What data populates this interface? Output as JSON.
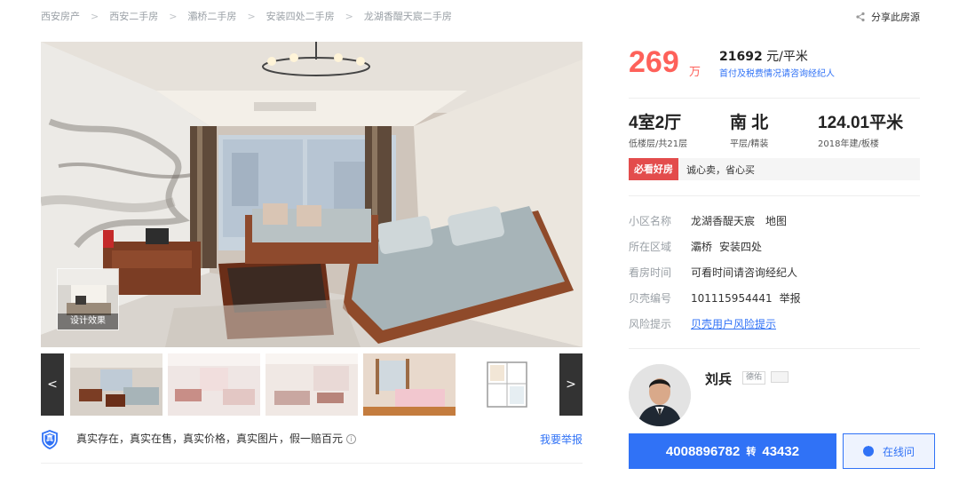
{
  "breadcrumb": [
    {
      "label": "西安房产"
    },
    {
      "label": "西安二手房"
    },
    {
      "label": "灞桥二手房"
    },
    {
      "label": "安装四处二手房"
    },
    {
      "label": "龙湖香醍天宸二手房"
    }
  ],
  "breadcrumb_sep": ">",
  "share": {
    "label": "分享此房源",
    "icon": "share-icon"
  },
  "gallery": {
    "design_label": "设计效果",
    "prev": "<",
    "next": ">",
    "thumbnails": [
      "living-room",
      "living-room-bright",
      "living-room-side",
      "bedroom",
      "floor-plan"
    ]
  },
  "guarantee": {
    "text": "真实存在，真实在售，真实价格，真实图片，假一赔百元",
    "badge": "真",
    "info_icon": "i",
    "report_label": "我要举报"
  },
  "price": {
    "total": "269",
    "total_unit": "万",
    "unit_price": "21692",
    "unit_price_suffix": " 元/平米",
    "tax_note": "首付及税费情况请咨询经纪人"
  },
  "room": [
    {
      "main": "4室2厅",
      "sub": "低楼层/共21层"
    },
    {
      "main": "南 北",
      "sub": "平层/精装"
    },
    {
      "main": "124.01平米",
      "sub": "2018年建/板楼"
    }
  ],
  "highlight": {
    "tag": "必看好房",
    "text": "诚心卖，省心买"
  },
  "info": {
    "community": {
      "label": "小区名称",
      "value": "龙湖香醍天宸",
      "extra": "地图"
    },
    "area": {
      "label": "所在区域",
      "value": "灞桥",
      "extra": "安装四处"
    },
    "viewing": {
      "label": "看房时间",
      "value": "可看时间请咨询经纪人"
    },
    "code": {
      "label": "贝壳编号",
      "value": "101115954441",
      "extra": "举报"
    },
    "risk": {
      "label": "风险提示",
      "value": "贝壳用户风险提示"
    }
  },
  "agent": {
    "name": "刘兵",
    "badge": "德佑",
    "phone": "4008896782",
    "transfer": "转",
    "ext": "43432",
    "online_label": "在线问"
  },
  "colors": {
    "accent": "#3072f6",
    "price": "#fe615a",
    "tag": "#e34c4c"
  }
}
